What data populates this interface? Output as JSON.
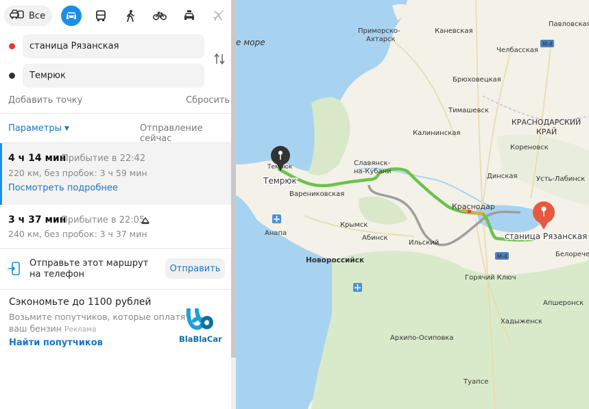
{
  "transport_modes": {
    "all_label": "Все",
    "items": [
      "car",
      "bus",
      "walk",
      "bicycle",
      "taxi",
      "plane"
    ],
    "active": "car"
  },
  "route_form": {
    "from": "станица Рязанская",
    "to": "Темрюк",
    "add_point": "Добавить точку",
    "reset": "Сбросить"
  },
  "options": {
    "params": "Параметры",
    "departure": "Отправление сейчас"
  },
  "routes": [
    {
      "duration": "4 ч 14 мин",
      "arrival": "Прибытие в 22:42",
      "details": "220 км, без пробок: 3 ч 59 мин",
      "more": "Посмотреть подробнее"
    },
    {
      "duration": "3 ч 37 мин",
      "arrival": "Прибытие в 22:05",
      "details": "240 км, без пробок: 3 ч 37 мин"
    }
  ],
  "send": {
    "text_line1": "Отправьте этот маршрут",
    "text_line2": "на телефон",
    "button": "Отправить"
  },
  "promo": {
    "title": "Сэкономьте до 1100 рублей",
    "line1": "Возьмите попутчиков, которые оплатят",
    "line2": "ваш бензин",
    "ad": "Реклама",
    "link": "Найти попутчиков",
    "brand": "BlaBlaCar"
  },
  "colors": {
    "accent": "#1a8fe8",
    "from_dot": "#e53935",
    "to_dot": "#333333",
    "route_main": "#6cc24a",
    "route_alt": "#9e9e9e",
    "destination_pin": "#e8573f"
  },
  "map": {
    "sea_label": "е море",
    "region_label_1": "КРАСНОДАРСКИЙ",
    "region_label_2": "КРАЙ",
    "road_badge": "М-4",
    "start_label": "Темрюк",
    "end_label": "станица Рязанская",
    "towns": [
      "Приморско-",
      "Ахтарск",
      "Каневская",
      "Павловская",
      "Челбасская",
      "Брюховецкая",
      "Тимашевск",
      "Калининская",
      "Кореновск",
      "Темрюк",
      "Славянск-",
      "на-Кубани",
      "Динская",
      "Усть-Лабинск",
      "Варениковская",
      "Краснодар",
      "Крымск",
      "Абинск",
      "Ильский",
      "Анапа",
      "Белоречен",
      "Новороссийск",
      "Горячий Ключ",
      "Апшеронск",
      "Хадыженск",
      "Архипо-Осиповка",
      "Туапсе"
    ]
  }
}
